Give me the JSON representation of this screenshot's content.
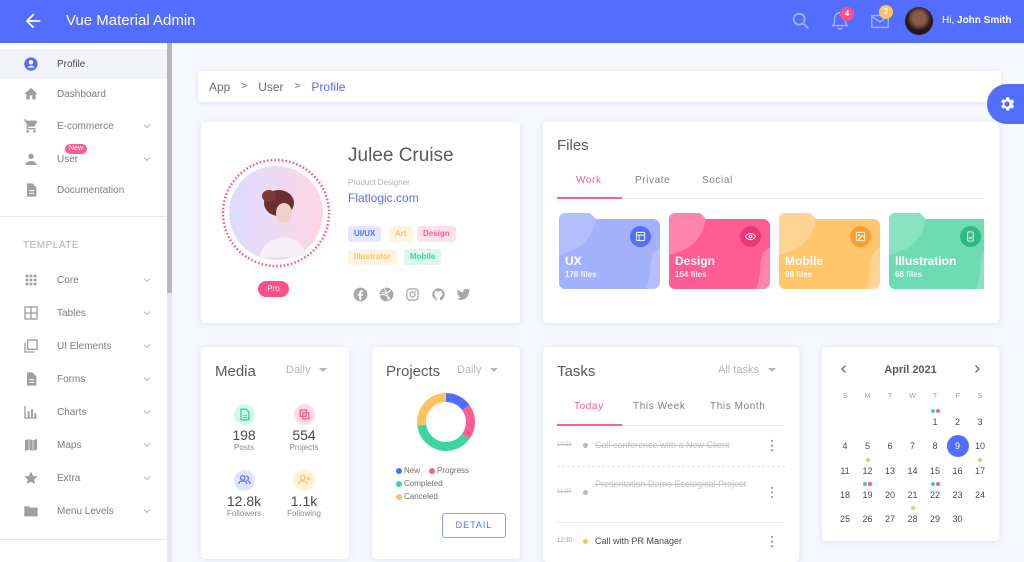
{
  "header": {
    "title": "Vue Material Admin",
    "notifications_count": "4",
    "messages_count": "3",
    "greeting_prefix": "Hi,",
    "user_name": "John Smith"
  },
  "sidebar": {
    "items": [
      {
        "label": "Profile",
        "icon": "account-circle-icon",
        "active": true
      },
      {
        "label": "Dashboard",
        "icon": "home-icon"
      },
      {
        "label": "E-commerce",
        "icon": "cart-icon",
        "expandable": true
      },
      {
        "label": "User",
        "icon": "person-icon",
        "expandable": true,
        "badge": "New"
      },
      {
        "label": "Documentation",
        "icon": "document-icon"
      }
    ],
    "section_title": "TEMPLATE",
    "template_items": [
      {
        "label": "Core",
        "icon": "grid-icon"
      },
      {
        "label": "Tables",
        "icon": "table-icon"
      },
      {
        "label": "UI Elements",
        "icon": "layers-icon"
      },
      {
        "label": "Forms",
        "icon": "form-icon"
      },
      {
        "label": "Charts",
        "icon": "chart-icon"
      },
      {
        "label": "Maps",
        "icon": "map-icon"
      },
      {
        "label": "Extra",
        "icon": "star-icon"
      },
      {
        "label": "Menu Levels",
        "icon": "folder-icon"
      }
    ]
  },
  "breadcrumb": {
    "items": [
      "App",
      "User"
    ],
    "current": "Profile"
  },
  "profile": {
    "name": "Julee Cruise",
    "role": "Product Designer",
    "link": "Flatlogic.com",
    "badge": "Pro",
    "tags": [
      {
        "label": "UI/UX",
        "color": "#536dfe",
        "bg": "#e3e7ff"
      },
      {
        "label": "Art",
        "color": "#ffc260",
        "bg": "#fff4e0"
      },
      {
        "label": "Design",
        "color": "#ff5c93",
        "bg": "#ffe0eb"
      },
      {
        "label": "Illustrator",
        "color": "#ffc260",
        "bg": "#fff4e0"
      },
      {
        "label": "Mobile",
        "color": "#3cd4a0",
        "bg": "#dcf7ee"
      }
    ],
    "socials": [
      "facebook",
      "dribbble",
      "instagram",
      "github",
      "twitter"
    ]
  },
  "files": {
    "title": "Files",
    "tabs": [
      "Work",
      "Private",
      "Social"
    ],
    "active_tab": 0,
    "folders": [
      {
        "name": "UX",
        "count": "178 files",
        "color": "#a2b1fc",
        "accent": "#536dfe",
        "icon": "layout-icon"
      },
      {
        "name": "Design",
        "count": "154 files",
        "color": "#ff5c93",
        "accent": "#e93a78",
        "icon": "eye-icon"
      },
      {
        "name": "Mobile",
        "count": "98 files",
        "color": "#ffc66e",
        "accent": "#ff9d2f",
        "icon": "image-icon"
      },
      {
        "name": "Illustration",
        "count": "68 files",
        "color": "#6ddbb4",
        "accent": "#2fb883",
        "icon": "phone-icon"
      }
    ]
  },
  "media": {
    "title": "Media",
    "period": "Daily",
    "stats": [
      {
        "value": "198",
        "label": "Posts",
        "icon": "post-icon",
        "color": "#3cd4a0",
        "bg": "#d6f6ea"
      },
      {
        "value": "554",
        "label": "Projects",
        "icon": "projects-icon",
        "color": "#ff5c93",
        "bg": "#ffdbe8"
      },
      {
        "value": "12.8k",
        "label": "Followers",
        "icon": "followers-icon",
        "color": "#536dfe",
        "bg": "#dfe4ff"
      },
      {
        "value": "1.1k",
        "label": "Following",
        "icon": "following-icon",
        "color": "#ffc260",
        "bg": "#fff0d6"
      }
    ]
  },
  "projects": {
    "title": "Projects",
    "period": "Daily",
    "detail_label": "DETAIL",
    "chart_data": {
      "type": "pie",
      "title": "Projects",
      "categories": [
        "New",
        "Progress",
        "Completed",
        "Canceled"
      ],
      "values": [
        15,
        20,
        38,
        27
      ],
      "colors": [
        "#536dfe",
        "#ff5c93",
        "#3cd4a0",
        "#ffc260"
      ],
      "legend": "bottom"
    }
  },
  "tasks": {
    "title": "Tasks",
    "filter": "All tasks",
    "tabs": [
      "Today",
      "This Week",
      "This Month"
    ],
    "active_tab": 0,
    "items": [
      {
        "time": "10:21",
        "text": "Call conference with a New Client",
        "done": true,
        "dot": "#b8b8b8"
      },
      {
        "time": "11:30",
        "text": "Presentation Demo Ecological Project",
        "done": true,
        "dot": "#b8b8b8"
      },
      {
        "time": "12:30",
        "text": "Call with PR Manager",
        "done": false,
        "dot": "#ffc260"
      }
    ]
  },
  "calendar": {
    "month_label": "April 2021",
    "weekdays": [
      "S",
      "M",
      "T",
      "W",
      "T",
      "F",
      "S"
    ],
    "first_weekday": 4,
    "days_in_month": 30,
    "selected_day": 9,
    "events": {
      "1": [
        "#3cd4a0",
        "#ff5c93"
      ],
      "12": [
        "#ffc260"
      ],
      "17": [
        "#ffc260"
      ],
      "19": [
        "#3cd4a0",
        "#ff5c93"
      ],
      "22": [
        "#3cd4a0",
        "#ff5c93"
      ],
      "28": [
        "#ffc260"
      ]
    }
  }
}
